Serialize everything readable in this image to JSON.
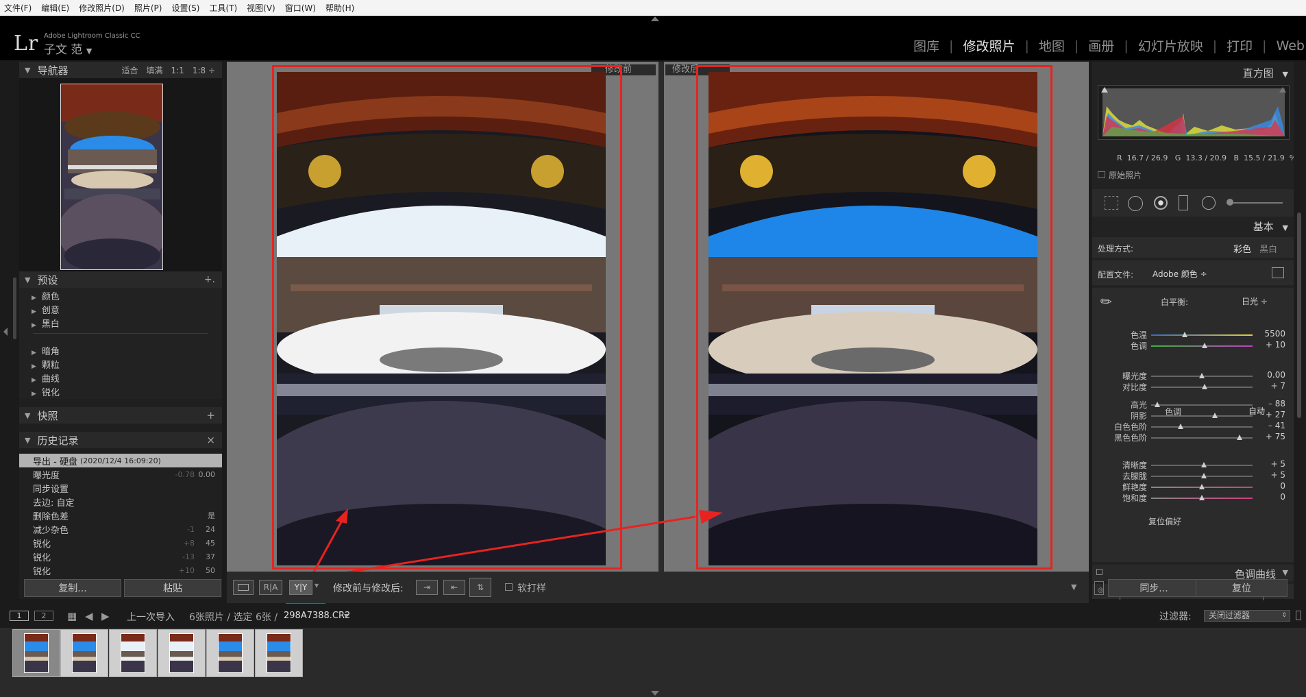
{
  "menu": [
    "文件(F)",
    "编辑(E)",
    "修改照片(D)",
    "照片(P)",
    "设置(S)",
    "工具(T)",
    "视图(V)",
    "窗口(W)",
    "帮助(H)"
  ],
  "app": {
    "logo": "Lr",
    "title": "Adobe Lightroom Classic CC",
    "user": "子文 范"
  },
  "modules": [
    {
      "label": "图库",
      "active": false
    },
    {
      "label": "修改照片",
      "active": true
    },
    {
      "label": "地图",
      "active": false
    },
    {
      "label": "画册",
      "active": false
    },
    {
      "label": "幻灯片放映",
      "active": false
    },
    {
      "label": "打印",
      "active": false
    },
    {
      "label": "Web",
      "active": false
    }
  ],
  "left": {
    "navigator": {
      "title": "导航器",
      "options": "适合　填满　1:1　1:8 ÷"
    },
    "presets": {
      "title": "预设",
      "add": "+.",
      "items": [
        "颜色",
        "创意",
        "黑白",
        "暗角",
        "颗粒",
        "曲线",
        "锐化"
      ]
    },
    "snapshots": {
      "title": "快照",
      "add": "+"
    },
    "history": {
      "title": "历史记录",
      "close": "×",
      "selected": {
        "label": "导出 - 硬盘",
        "sub": "(2020/12/4 16:09:20)"
      },
      "items": [
        {
          "label": "曝光度",
          "v1": "-0.78",
          "v2": "0.00"
        },
        {
          "label": "同步设置",
          "v1": "",
          "v2": ""
        },
        {
          "label": "去边: 自定",
          "v1": "",
          "v2": ""
        },
        {
          "label": "删除色差",
          "v1": "",
          "v2": "是"
        },
        {
          "label": "减少杂色",
          "v1": "-1",
          "v2": "24"
        },
        {
          "label": "锐化",
          "v1": "+8",
          "v2": "45"
        },
        {
          "label": "锐化",
          "v1": "-13",
          "v2": "37"
        },
        {
          "label": "锐化",
          "v1": "+10",
          "v2": "50"
        }
      ]
    },
    "copy_btn": "复制...",
    "paste_btn": "粘贴"
  },
  "center": {
    "before_label": "修改前",
    "after_label": "修改后"
  },
  "toolbar": {
    "btn_single": "",
    "btn_ra": "R|A",
    "btn_yy": "Y|Y",
    "compare_label": "修改前与修改后:",
    "proof_label": "软打样"
  },
  "right": {
    "histogram": {
      "title": "直方图",
      "rgb": "R  16.7 / 26.9   G  13.3 / 20.9   B  15.5 / 21.9  %",
      "original": "原始照片"
    },
    "basic": {
      "title": "基本",
      "treatment_label": "处理方式:",
      "treatment_color": "彩色",
      "treatment_bw": "黑白",
      "profile_label": "配置文件:",
      "profile_value": "Adobe 颜色 ÷",
      "wb_label": "白平衡:",
      "wb_value": "日光 ÷",
      "tone_label": "色调",
      "auto": "自动",
      "presence_label": "偏好",
      "presence_prefix": "复位",
      "sliders": [
        {
          "label": "色温",
          "value": "5500",
          "pos": 0.33,
          "group": "wb"
        },
        {
          "label": "色调",
          "value": "+ 10",
          "pos": 0.53,
          "group": "wb"
        },
        {
          "label": "曝光度",
          "value": "0.00",
          "pos": 0.5,
          "group": "tone"
        },
        {
          "label": "对比度",
          "value": "+ 7",
          "pos": 0.53,
          "group": "tone"
        },
        {
          "label": "高光",
          "value": "– 88",
          "pos": 0.06,
          "group": "tone2"
        },
        {
          "label": "阴影",
          "value": "+ 27",
          "pos": 0.63,
          "group": "tone2"
        },
        {
          "label": "白色色阶",
          "value": "– 41",
          "pos": 0.29,
          "group": "tone2"
        },
        {
          "label": "黑色色阶",
          "value": "+ 75",
          "pos": 0.87,
          "group": "tone2"
        },
        {
          "label": "清晰度",
          "value": "+ 5",
          "pos": 0.52,
          "group": "presence"
        },
        {
          "label": "去朦胧",
          "value": "+ 5",
          "pos": 0.52,
          "group": "presence"
        },
        {
          "label": "鲜艳度",
          "value": "0",
          "pos": 0.5,
          "group": "presence"
        },
        {
          "label": "饱和度",
          "value": "0",
          "pos": 0.5,
          "group": "presence"
        }
      ]
    },
    "curve": {
      "title": "色调曲线"
    },
    "sync_btn": "同步...",
    "reset_btn": "复位"
  },
  "filmbar": {
    "view1": "1",
    "view2": "2",
    "source": "上一次导入",
    "count": "6张照片 / 选定 6张 /",
    "filename": "298A7388.CR2",
    "filter_label": "过滤器:",
    "filter_value": "关闭过滤器"
  },
  "filmstrip": {
    "count": 6
  }
}
